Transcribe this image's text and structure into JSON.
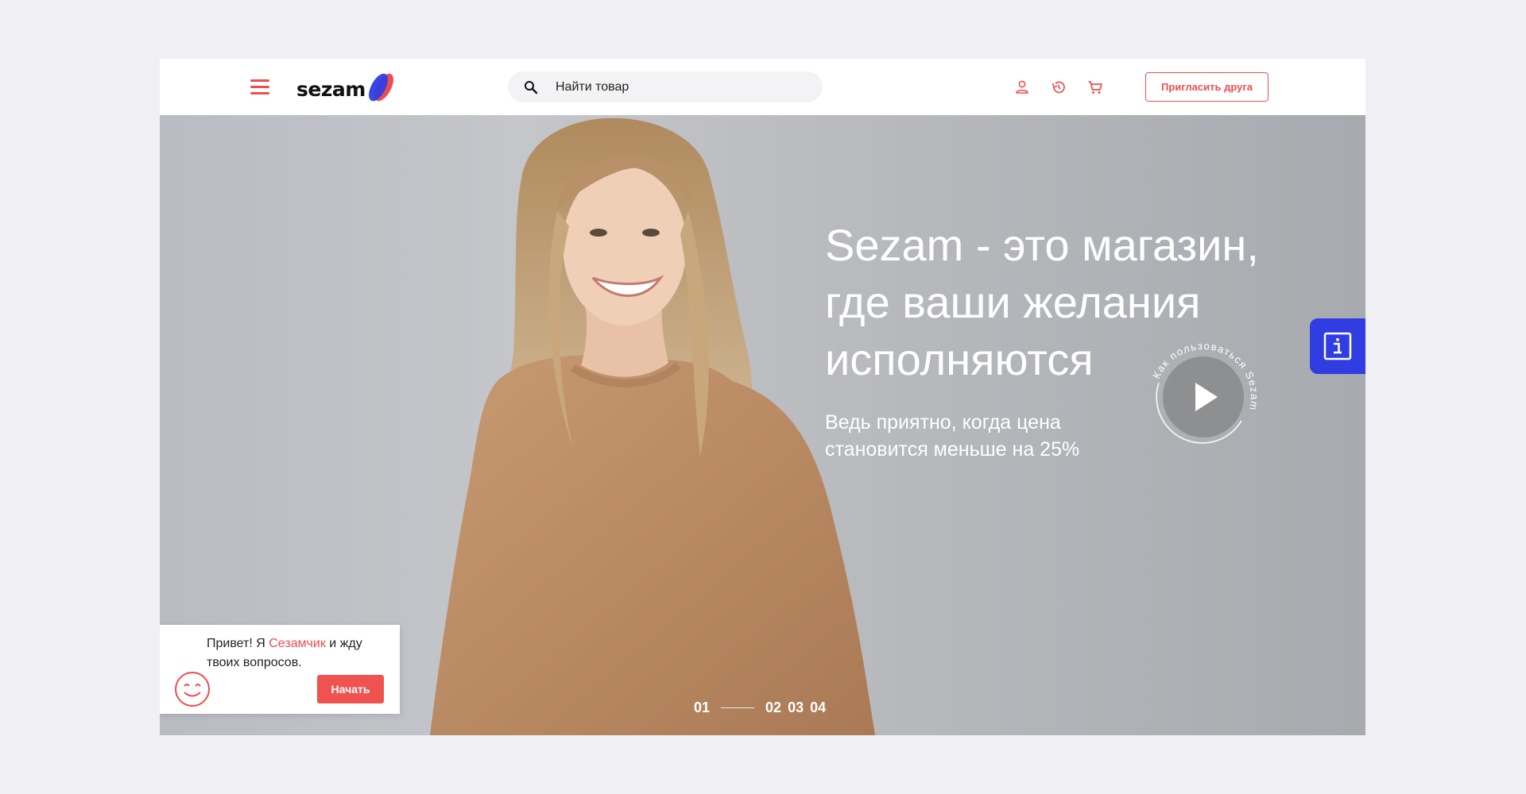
{
  "header": {
    "logo_text": "sezam",
    "search_placeholder": "Найти товар",
    "invite_label": "Пригласить друга",
    "icons": [
      "menu-icon",
      "user-icon",
      "history-icon",
      "cart-icon",
      "search-icon"
    ]
  },
  "hero": {
    "headline_lines": [
      "Sezam - это магазин,",
      "где ваши желания",
      "исполняются"
    ],
    "subline_lines": [
      "Ведь приятно, когда цена",
      "становится меньше на 25%"
    ],
    "video_caption": "Как пользоваться Sezam",
    "slides": [
      "01",
      "02",
      "03",
      "04"
    ],
    "active_slide": 0
  },
  "chat": {
    "text_before": "Привет! Я ",
    "bot_name": "Сезамчик",
    "text_after": " и жду твоих вопросов.",
    "start_label": "Начать"
  },
  "colors": {
    "accent": "#ef4d4d",
    "info_button": "#2f3de3",
    "page_bg": "#f0eff4"
  }
}
